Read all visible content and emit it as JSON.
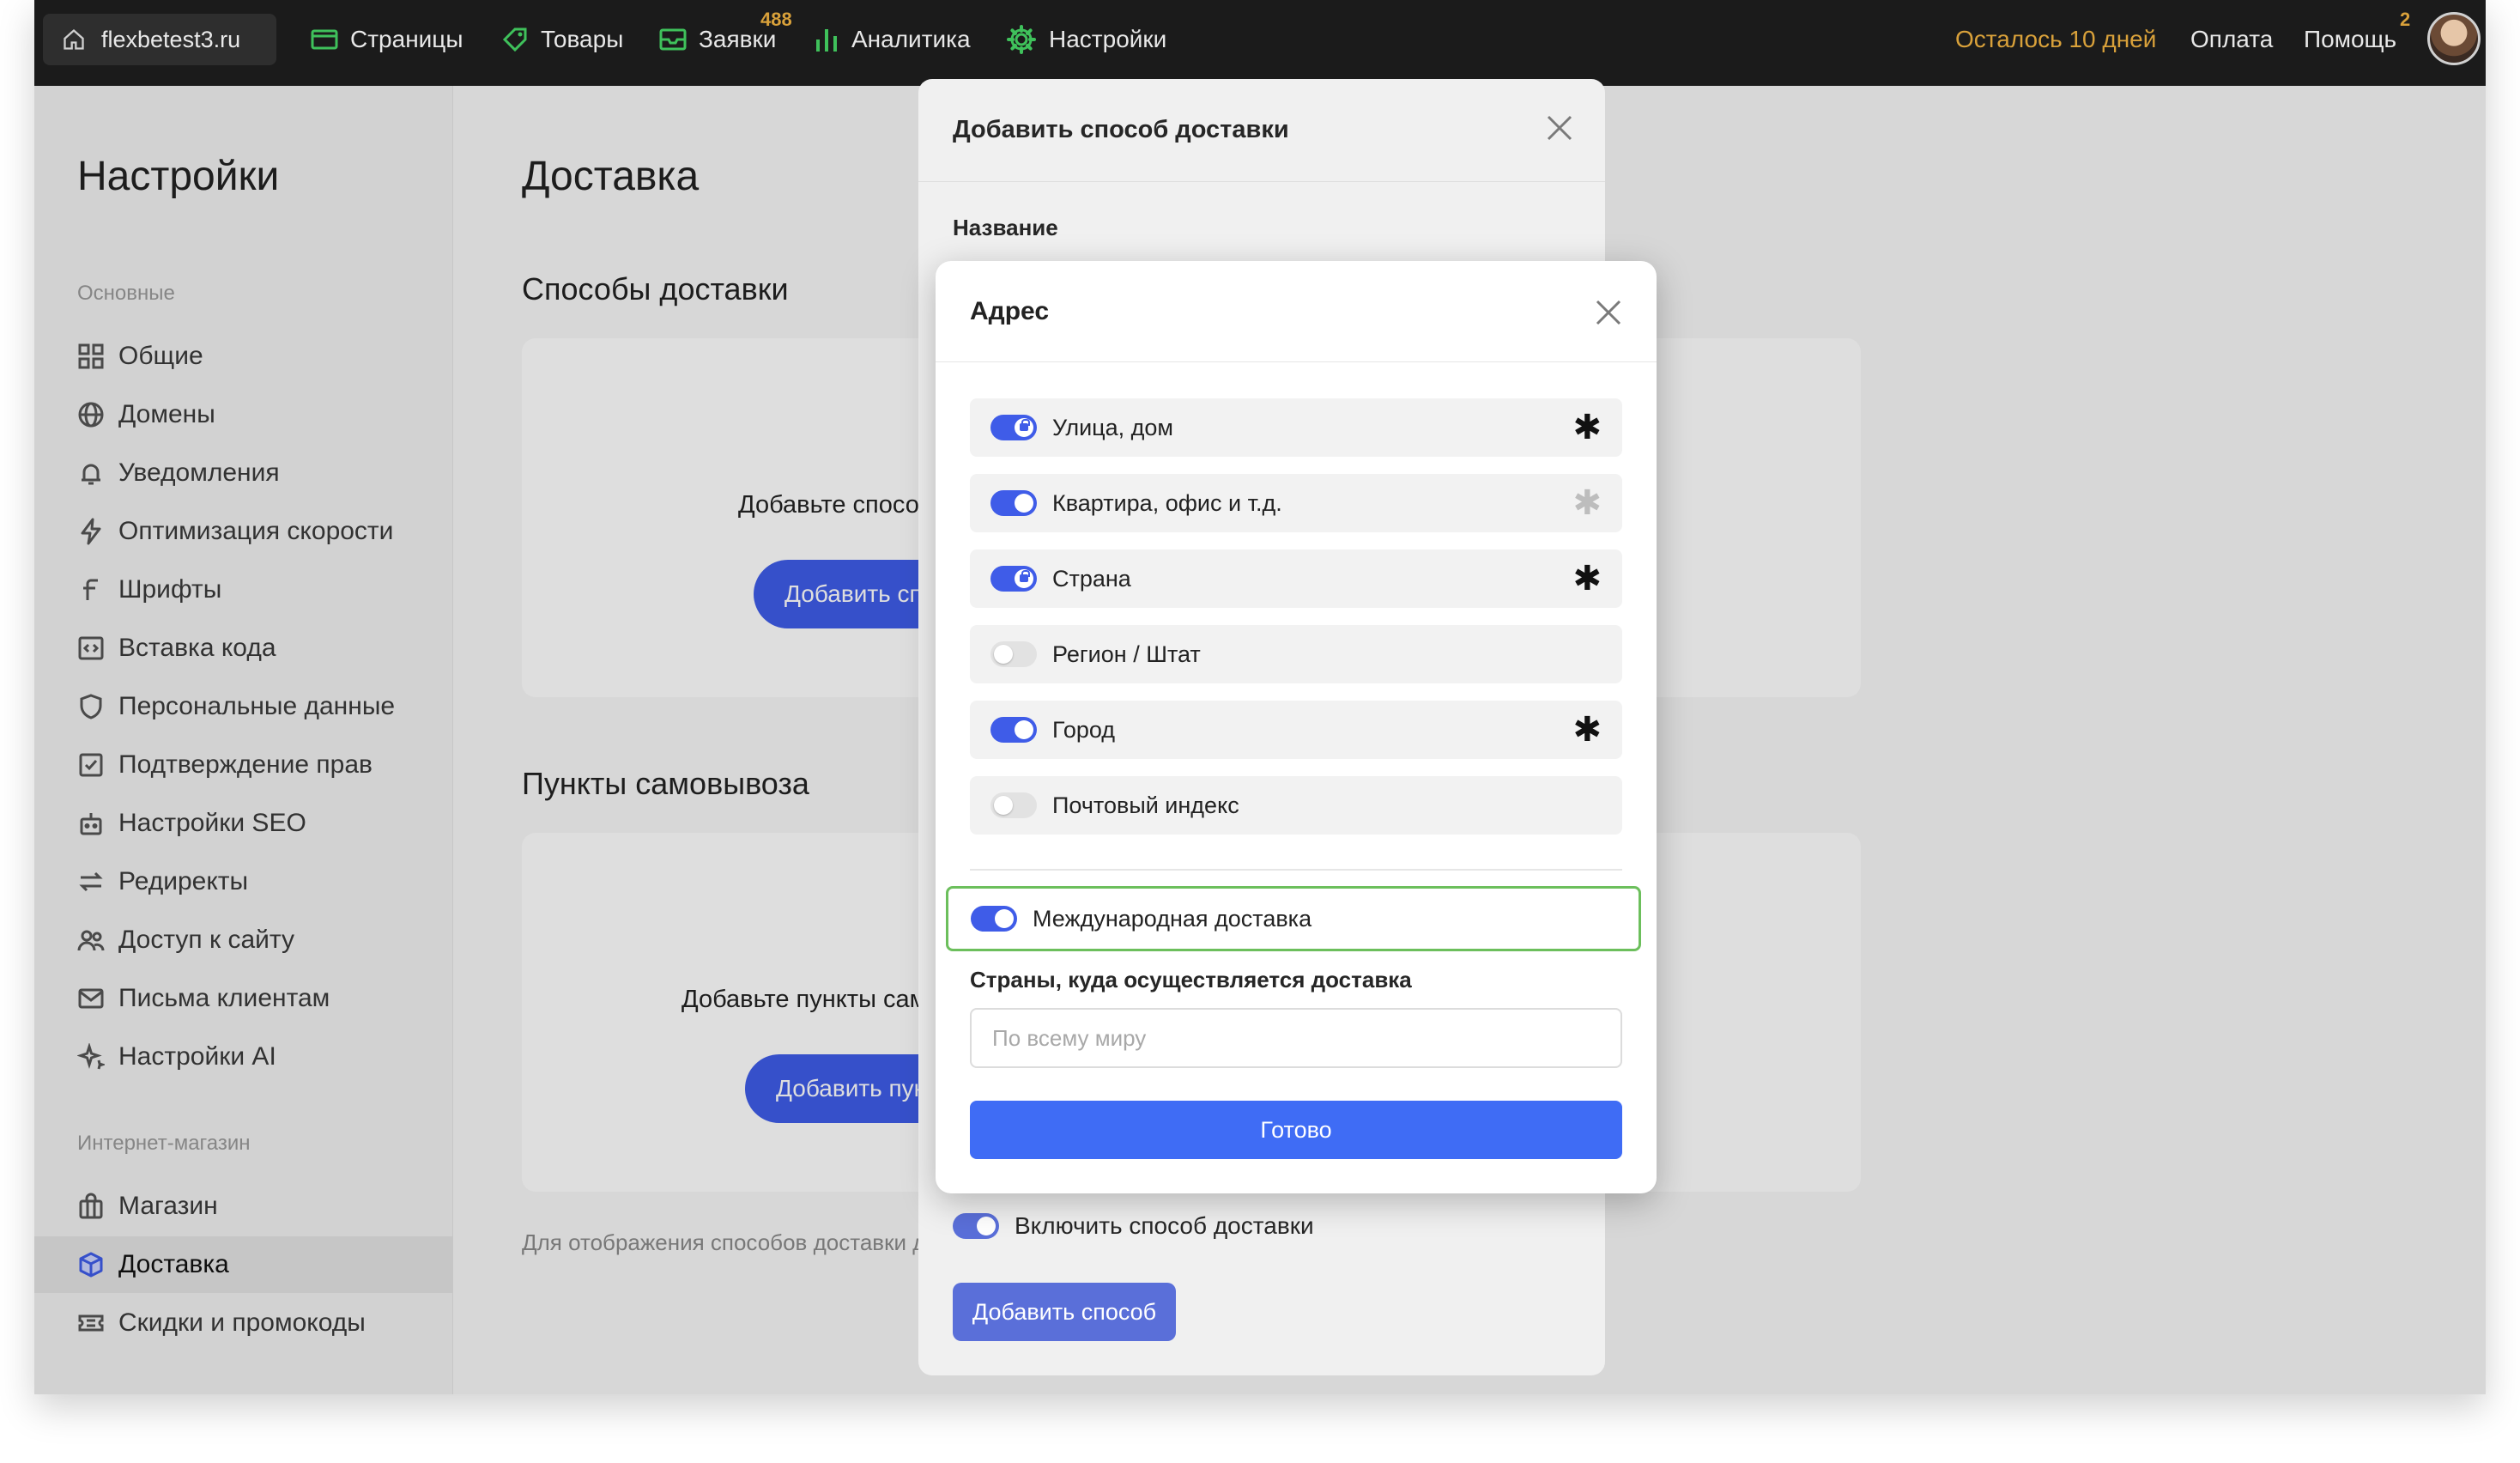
{
  "topnav": {
    "site": "flexbetest3.ru",
    "items": [
      {
        "label": "Страницы",
        "icon": "pages-icon"
      },
      {
        "label": "Товары",
        "icon": "tag-icon"
      },
      {
        "label": "Заявки",
        "icon": "inbox-icon",
        "badge": "488"
      },
      {
        "label": "Аналитика",
        "icon": "chart-icon"
      },
      {
        "label": "Настройки",
        "icon": "gear-icon"
      }
    ],
    "trial": "Осталось 10 дней",
    "payment": "Оплата",
    "help": "Помощь",
    "help_badge": "2",
    "accent_color": "#d9a13a"
  },
  "sidebar": {
    "title": "Настройки",
    "sections": [
      {
        "label": "Основные",
        "items": [
          "Общие",
          "Домены",
          "Уведомления",
          "Оптимизация скорости",
          "Шрифты",
          "Вставка кода",
          "Персональные данные",
          "Подтверждение прав",
          "Настройки SEO",
          "Редиректы",
          "Доступ к сайту",
          "Письма клиентам",
          "Настройки AI"
        ]
      },
      {
        "label": "Интернет-магазин",
        "items": [
          "Магазин",
          "Доставка",
          "Скидки и промокоды"
        ],
        "active": "Доставка"
      }
    ]
  },
  "main": {
    "title": "Доставка",
    "delivery_section": "Способы доставки",
    "delivery_card_text": "Добавьте способ доставки",
    "delivery_card_button": "Добавить способ",
    "pickup_section": "Пункты самовывоза",
    "pickup_card_text": "Добавьте пункты самовывоза",
    "pickup_card_button": "Добавить пункт",
    "hint": "Для отображения способов доставки добавьте блок оформления заказа в корзине"
  },
  "modal_back": {
    "title": "Добавить способ доставки",
    "name_label": "Название",
    "enable_label": "Включить способ доставки",
    "enable_on": true,
    "submit": "Добавить способ"
  },
  "modal_front": {
    "title": "Адрес",
    "fields": [
      {
        "label": "Улица, дом",
        "on": true,
        "locked": true,
        "required": true
      },
      {
        "label": "Квартира, офис и т.д.",
        "on": true,
        "locked": false,
        "required": false
      },
      {
        "label": "Страна",
        "on": true,
        "locked": true,
        "required": true
      },
      {
        "label": "Регион / Штат",
        "on": false,
        "locked": false,
        "required": false
      },
      {
        "label": "Город",
        "on": true,
        "locked": false,
        "required": true
      },
      {
        "label": "Почтовый индекс",
        "on": false,
        "locked": false,
        "required": false
      }
    ],
    "international_label": "Международная доставка",
    "international_on": true,
    "countries_label": "Страны, куда осуществляется доставка",
    "countries_placeholder": "По всему миру",
    "done": "Готово",
    "primary_color": "#3f6cf5",
    "highlight_color": "#6cbf5c"
  }
}
